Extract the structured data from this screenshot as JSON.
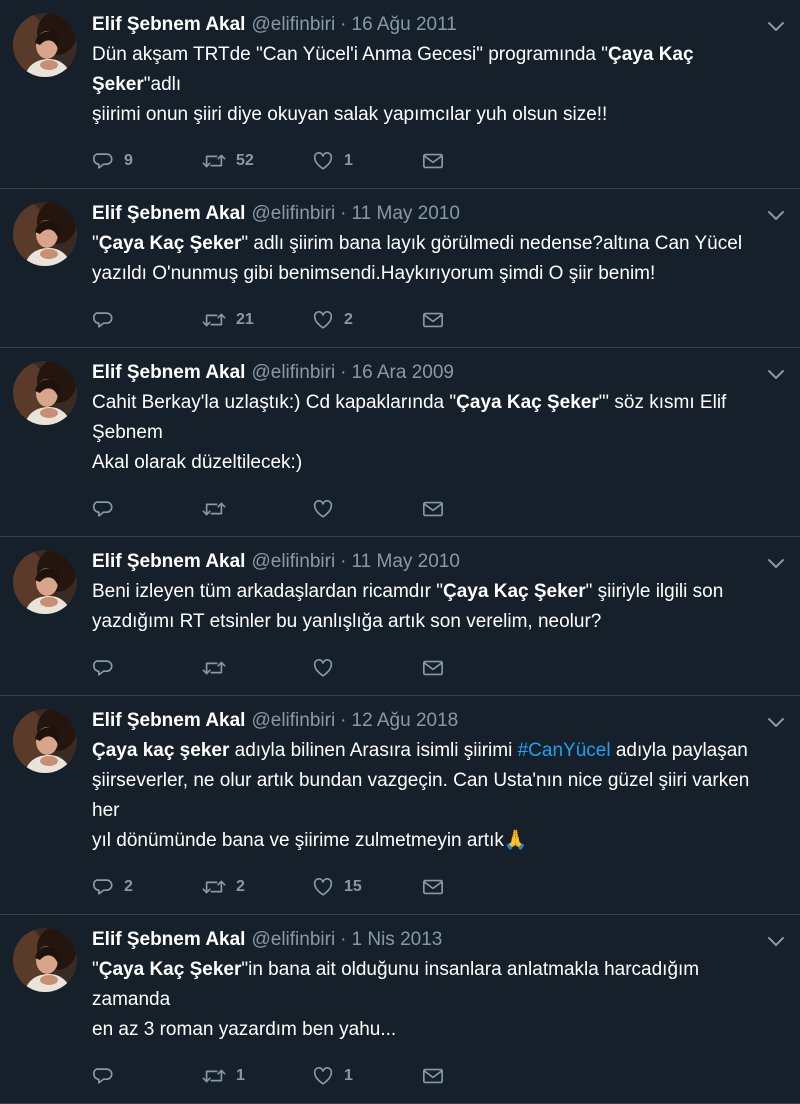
{
  "author": {
    "name": "Elif Şebnem Akal",
    "handle": "@elifinbiri",
    "separator": "·"
  },
  "colors": {
    "background": "#15202b",
    "divider": "#38444d",
    "muted": "#8899a6",
    "link": "#1da1f2"
  },
  "tweets": [
    {
      "date": "16 Ağu 2011",
      "lines": [
        [
          {
            "t": "Dün akşam TRTde \"Can Yücel'i Anma Gecesi\" programında \""
          },
          {
            "t": "Çaya Kaç Şeker",
            "b": true
          },
          {
            "t": "\"adlı"
          }
        ],
        [
          {
            "t": "şiirimi onun şiiri diye okuyan salak yapımcılar yuh olsun size!!"
          }
        ]
      ],
      "replies": "9",
      "retweets": "52",
      "likes": "1"
    },
    {
      "date": "11 May 2010",
      "lines": [
        [
          {
            "t": "\""
          },
          {
            "t": "Çaya Kaç Şeker",
            "b": true
          },
          {
            "t": "\" adlı şiirim bana layık görülmedi nedense?altına Can Yücel"
          }
        ],
        [
          {
            "t": "yazıldı O'nunmuş gibi benimsendi.Haykırıyorum şimdi O şiir benim!"
          }
        ]
      ],
      "replies": "",
      "retweets": "21",
      "likes": "2"
    },
    {
      "date": "16 Ara 2009",
      "lines": [
        [
          {
            "t": "Cahit Berkay'la uzlaştık:) Cd kapaklarında \""
          },
          {
            "t": "Çaya Kaç Şeker",
            "b": true
          },
          {
            "t": "\"' söz kısmı Elif Şebnem"
          }
        ],
        [
          {
            "t": "Akal olarak düzeltilecek:)"
          }
        ]
      ],
      "replies": "",
      "retweets": "",
      "likes": ""
    },
    {
      "date": "11 May 2010",
      "lines": [
        [
          {
            "t": "Beni izleyen tüm arkadaşlardan ricamdır \""
          },
          {
            "t": "Çaya Kaç Şeker",
            "b": true
          },
          {
            "t": "\" şiiriyle ilgili son"
          }
        ],
        [
          {
            "t": "yazdığımı RT etsinler bu yanlışlığa artık son verelim, neolur?"
          }
        ]
      ],
      "replies": "",
      "retweets": "",
      "likes": ""
    },
    {
      "date": "12 Ağu 2018",
      "lines": [
        [
          {
            "t": "Çaya kaç şeker",
            "b": true
          },
          {
            "t": " adıyla bilinen Arasıra isimli şiirimi "
          },
          {
            "t": "#CanYücel",
            "h": true
          },
          {
            "t": " adıyla paylaşan"
          }
        ],
        [
          {
            "t": "şiirseverler, ne olur artık bundan vazgeçin. Can Usta'nın nice güzel şiiri varken her"
          }
        ],
        [
          {
            "t": "yıl dönümünde bana ve şiirime zulmetmeyin artık🙏"
          }
        ]
      ],
      "replies": "2",
      "retweets": "2",
      "likes": "15"
    },
    {
      "date": "1 Nis 2013",
      "lines": [
        [
          {
            "t": "\""
          },
          {
            "t": "Çaya Kaç Şeker",
            "b": true
          },
          {
            "t": "\"in bana ait olduğunu insanlara anlatmakla harcadığım zamanda"
          }
        ],
        [
          {
            "t": "en az 3 roman yazardım ben yahu..."
          }
        ]
      ],
      "replies": "",
      "retweets": "1",
      "likes": "1"
    }
  ]
}
